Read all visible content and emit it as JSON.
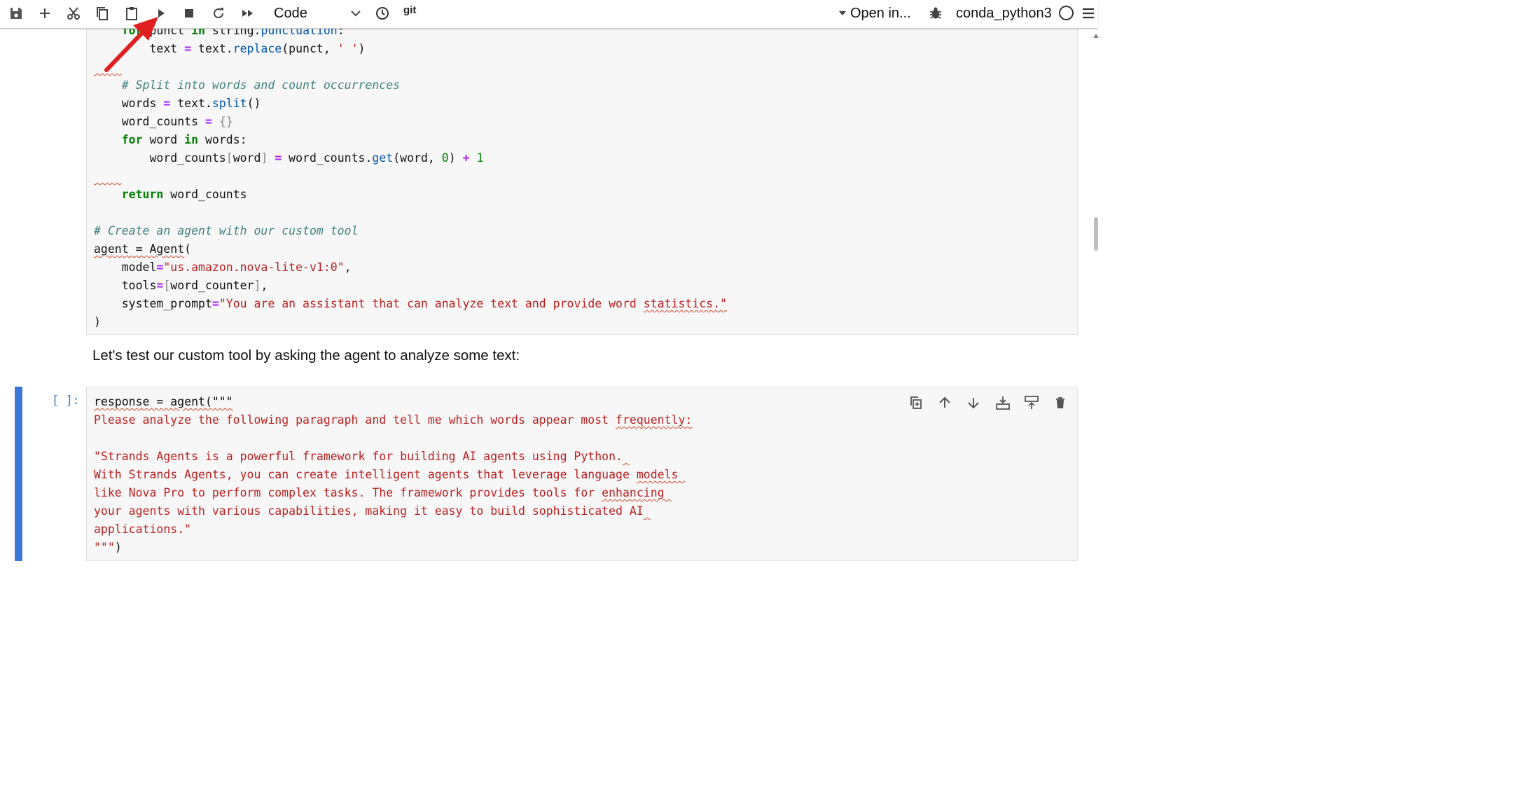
{
  "toolbar": {
    "buttons": [
      {
        "name": "save-icon"
      },
      {
        "name": "add-cell-icon"
      },
      {
        "name": "cut-icon"
      },
      {
        "name": "copy-icon"
      },
      {
        "name": "paste-icon"
      },
      {
        "name": "run-icon"
      },
      {
        "name": "stop-icon"
      },
      {
        "name": "restart-icon"
      },
      {
        "name": "run-all-icon"
      }
    ],
    "cell_type": "Code",
    "git_label": "git",
    "open_in": "Open in...",
    "kernel_name": "conda_python3"
  },
  "cells": {
    "markdown_text": "Let's test our custom tool by asking the agent to analyze some text:",
    "active_prompt": "[ ]:"
  },
  "colors": {
    "accent": "#3b78d4",
    "annotation_arrow": "#e02020",
    "keyword": "#008000",
    "string": "#ba2121",
    "comment": "#408080"
  }
}
